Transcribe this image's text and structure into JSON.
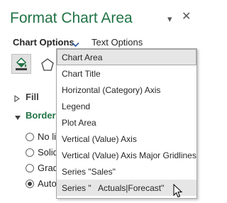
{
  "pane": {
    "title": "Format Chart Area",
    "collapse_glyph": "▾",
    "close_glyph": "✕"
  },
  "tabs": {
    "chart_options_label": "Chart Options",
    "text_options_label": "Text Options",
    "chevron_icon": "chevron-down-icon"
  },
  "icons": {
    "fill_line": "paint-bucket-icon",
    "effects": "pentagon-effects-icon"
  },
  "sections": {
    "fill_label": "Fill",
    "border_label": "Border"
  },
  "border_options": [
    {
      "label": "No line",
      "checked": false
    },
    {
      "label": "Solid line",
      "checked": false
    },
    {
      "label": "Gradient line",
      "checked": false
    },
    {
      "label": "Automatic",
      "checked": true
    }
  ],
  "dropdown": {
    "items": [
      {
        "label": "Chart Area",
        "state": "selected"
      },
      {
        "label": "Chart Title",
        "state": "normal"
      },
      {
        "label": "Horizontal (Category) Axis",
        "state": "normal"
      },
      {
        "label": "Legend",
        "state": "normal"
      },
      {
        "label": "Plot Area",
        "state": "normal"
      },
      {
        "label": "Vertical (Value) Axis",
        "state": "normal"
      },
      {
        "label": "Vertical (Value) Axis Major Gridlines",
        "state": "normal"
      },
      {
        "label": "Series \"Sales\"",
        "state": "normal"
      },
      {
        "label": "Series \"   Actuals|Forecast\"",
        "state": "hover"
      }
    ]
  },
  "colors": {
    "accent": "#217346",
    "chevron": "#2b579a",
    "menu_highlight": "#e6e6e6"
  }
}
